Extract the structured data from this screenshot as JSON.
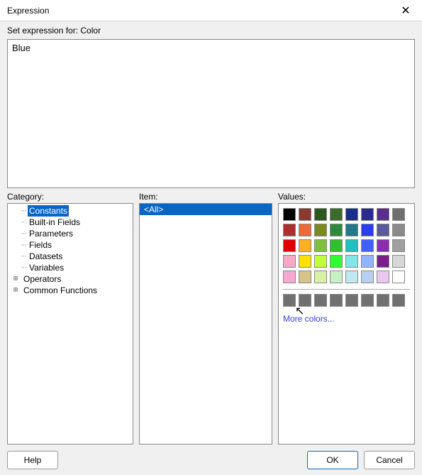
{
  "window": {
    "title": "Expression",
    "close_glyph": "✕"
  },
  "labels": {
    "set_expression_for": "Set expression for: Color",
    "category": "Category:",
    "item": "Item:",
    "values": "Values:",
    "more_colors": "More colors..."
  },
  "expression": {
    "text": "Blue"
  },
  "categories": [
    {
      "label": "Constants",
      "expandable": false,
      "selected": true
    },
    {
      "label": "Built-in Fields",
      "expandable": false,
      "selected": false
    },
    {
      "label": "Parameters",
      "expandable": false,
      "selected": false
    },
    {
      "label": "Fields",
      "expandable": false,
      "selected": false
    },
    {
      "label": "Datasets",
      "expandable": false,
      "selected": false
    },
    {
      "label": "Variables",
      "expandable": false,
      "selected": false
    },
    {
      "label": "Operators",
      "expandable": true,
      "selected": false
    },
    {
      "label": "Common Functions",
      "expandable": true,
      "selected": false
    }
  ],
  "items": [
    {
      "label": "<All>",
      "selected": true
    }
  ],
  "palette_main": [
    "#000000",
    "#8b3a2f",
    "#2d581e",
    "#3a6b2b",
    "#1a2d8c",
    "#2a2a90",
    "#5a2d8c",
    "#6f6f6f",
    "#b02e2e",
    "#ec6a3a",
    "#7a8a1f",
    "#2d8a3a",
    "#1f7a8a",
    "#2a3ef0",
    "#5a5a9c",
    "#8a8a8a",
    "#e00000",
    "#ffb020",
    "#7fc040",
    "#2fbf2f",
    "#20c0c0",
    "#4060ff",
    "#8a2db0",
    "#a0a0a0",
    "#f7a8c4",
    "#ffe000",
    "#c0ff3a",
    "#30ff30",
    "#80e8e8",
    "#90b4ff",
    "#7a1f8a",
    "#d8d8d8",
    "#f7a8d0",
    "#d6c38a",
    "#d8f0a8",
    "#c8f0c8",
    "#c0e8f0",
    "#b8cff0",
    "#e8c8f0",
    "#ffffff"
  ],
  "palette_greys": [
    "#707070",
    "#707070",
    "#707070",
    "#707070",
    "#707070",
    "#707070",
    "#707070",
    "#707070"
  ],
  "buttons": {
    "help": "Help",
    "ok": "OK",
    "cancel": "Cancel"
  }
}
